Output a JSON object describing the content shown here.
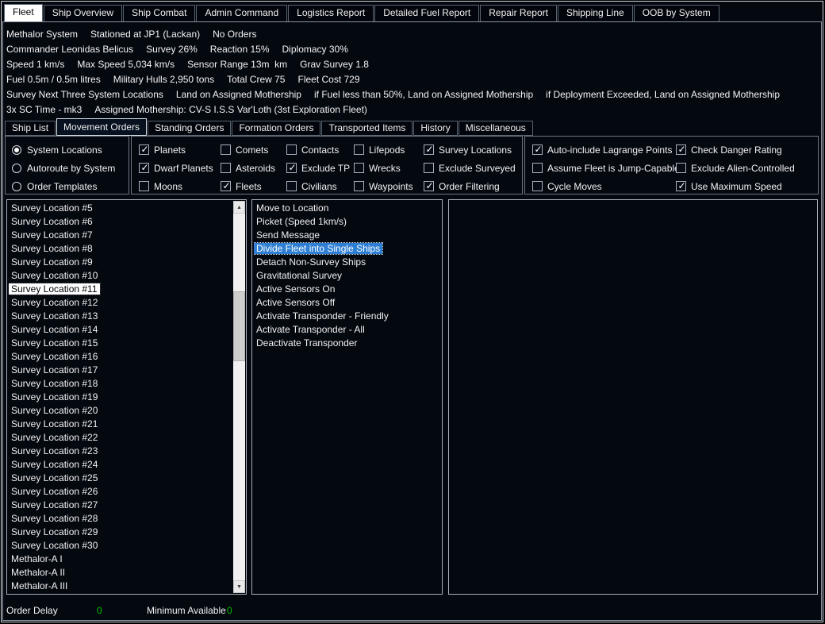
{
  "top_tabs": [
    {
      "label": "Fleet",
      "selected": true
    },
    {
      "label": "Ship Overview"
    },
    {
      "label": "Ship Combat"
    },
    {
      "label": "Admin Command"
    },
    {
      "label": "Logistics Report"
    },
    {
      "label": "Detailed Fuel Report"
    },
    {
      "label": "Repair Report"
    },
    {
      "label": "Shipping Line"
    },
    {
      "label": "OOB by System"
    }
  ],
  "summary": {
    "line1": [
      "Methalor System",
      "Stationed at JP1 (Lackan)",
      "No Orders"
    ],
    "line2": [
      "Commander Leonidas Belicus",
      "Survey 26%",
      "Reaction 15%",
      "Diplomacy 30%"
    ],
    "line3": [
      "Speed 1 km/s",
      "Max Speed 5,034 km/s",
      "Sensor Range 13m  km",
      "Grav Survey 1.8"
    ],
    "line4": [
      "Fuel 0.5m / 0.5m litres",
      "Military Hulls 2,950 tons",
      "Total Crew 75",
      "Fleet Cost 729"
    ],
    "line5": [
      "Survey Next Three System Locations",
      "Land on Assigned Mothership",
      "if Fuel less than 50%, Land on Assigned Mothership",
      "if Deployment Exceeded, Land on Assigned Mothership"
    ],
    "line6": [
      "3x SC Time - mk3",
      "Assigned Mothership: CV-S I.S.S Var'Loth (3st Exploration Fleet)"
    ]
  },
  "sub_tabs": [
    {
      "label": "Ship List"
    },
    {
      "label": "Movement Orders",
      "selected": true
    },
    {
      "label": "Standing Orders"
    },
    {
      "label": "Formation Orders"
    },
    {
      "label": "Transported Items"
    },
    {
      "label": "History"
    },
    {
      "label": "Miscellaneous"
    }
  ],
  "display_mode": [
    {
      "label": "System Locations",
      "selected": true
    },
    {
      "label": "Autoroute by System"
    },
    {
      "label": "Order Templates"
    }
  ],
  "filters": {
    "col1": [
      {
        "label": "Planets",
        "checked": true
      },
      {
        "label": "Dwarf Planets",
        "checked": true
      },
      {
        "label": "Moons",
        "checked": false
      }
    ],
    "col2": [
      {
        "label": "Comets",
        "checked": false
      },
      {
        "label": "Asteroids",
        "checked": false
      },
      {
        "label": "Fleets",
        "checked": true
      }
    ],
    "col3": [
      {
        "label": "Contacts",
        "checked": false
      },
      {
        "label": "Exclude TP",
        "checked": true
      },
      {
        "label": "Civilians",
        "checked": false
      }
    ],
    "col4": [
      {
        "label": "Lifepods",
        "checked": false
      },
      {
        "label": "Wrecks",
        "checked": false
      },
      {
        "label": "Waypoints",
        "checked": false
      }
    ],
    "col5": [
      {
        "label": "Survey Locations",
        "checked": true
      },
      {
        "label": "Exclude Surveyed",
        "checked": false
      },
      {
        "label": "Order Filtering",
        "checked": true
      }
    ]
  },
  "options": {
    "col1": [
      {
        "label": "Auto-include Lagrange Points",
        "checked": true
      },
      {
        "label": "Assume Fleet is Jump-Capable",
        "checked": false
      },
      {
        "label": "Cycle Moves",
        "checked": false
      }
    ],
    "col2": [
      {
        "label": "Check Danger Rating",
        "checked": true
      },
      {
        "label": "Exclude Alien-Controlled",
        "checked": false
      },
      {
        "label": "Use Maximum Speed",
        "checked": true
      }
    ]
  },
  "location_list": [
    {
      "label": "Survey Location #5"
    },
    {
      "label": "Survey Location #6"
    },
    {
      "label": "Survey Location #7"
    },
    {
      "label": "Survey Location #8"
    },
    {
      "label": "Survey Location #9"
    },
    {
      "label": "Survey Location #10"
    },
    {
      "label": "Survey Location #11",
      "selected": true
    },
    {
      "label": "Survey Location #12"
    },
    {
      "label": "Survey Location #13"
    },
    {
      "label": "Survey Location #14"
    },
    {
      "label": "Survey Location #15"
    },
    {
      "label": "Survey Location #16"
    },
    {
      "label": "Survey Location #17"
    },
    {
      "label": "Survey Location #18"
    },
    {
      "label": "Survey Location #19"
    },
    {
      "label": "Survey Location #20"
    },
    {
      "label": "Survey Location #21"
    },
    {
      "label": "Survey Location #22"
    },
    {
      "label": "Survey Location #23"
    },
    {
      "label": "Survey Location #24"
    },
    {
      "label": "Survey Location #25"
    },
    {
      "label": "Survey Location #26"
    },
    {
      "label": "Survey Location #27"
    },
    {
      "label": "Survey Location #28"
    },
    {
      "label": "Survey Location #29"
    },
    {
      "label": "Survey Location #30"
    },
    {
      "label": "Methalor-A I"
    },
    {
      "label": "Methalor-A II"
    },
    {
      "label": "Methalor-A III"
    }
  ],
  "orders_list": [
    {
      "label": "Move to Location"
    },
    {
      "label": "Picket (Speed 1km/s)"
    },
    {
      "label": "Send Message"
    },
    {
      "label": "Divide Fleet into Single Ships",
      "selected": true
    },
    {
      "label": "Detach Non-Survey Ships"
    },
    {
      "label": "Gravitational Survey"
    },
    {
      "label": "Active Sensors On"
    },
    {
      "label": "Active Sensors Off"
    },
    {
      "label": "Activate Transponder - Friendly"
    },
    {
      "label": "Activate Transponder - All"
    },
    {
      "label": "Deactivate Transponder"
    }
  ],
  "icons": {
    "scroll_up": "▲",
    "scroll_down": "▼"
  },
  "footer": {
    "order_delay_label": "Order Delay",
    "order_delay_value": "0",
    "minimum_available_label": "Minimum Available",
    "minimum_available_value": "0"
  }
}
